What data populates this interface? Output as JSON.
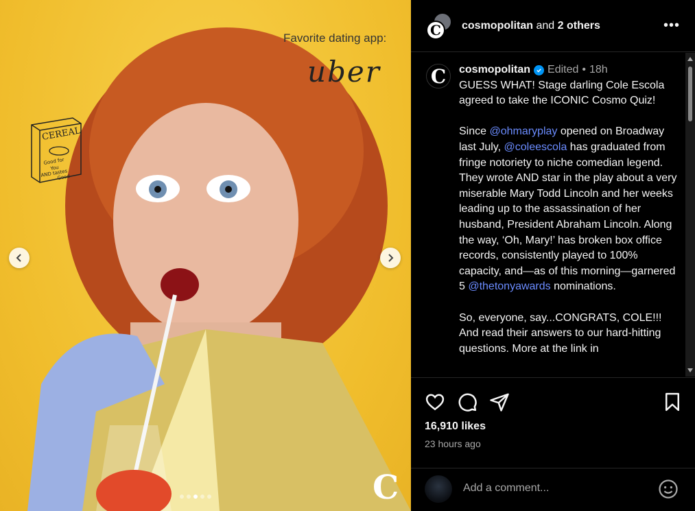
{
  "media": {
    "quiz_question": "Favorite dating app:",
    "quiz_answer": "uber",
    "cereal_box": [
      "CEREAL",
      "Good for",
      "You",
      "AND tastes",
      "Good"
    ],
    "brand_mark": "C",
    "dots_count": 5,
    "active_dot": 2
  },
  "header": {
    "username": "cosmopolitan",
    "joiner": "and",
    "others": "2 others",
    "avatar_letter": "C",
    "more_label": "•••"
  },
  "caption": {
    "avatar_letter": "C",
    "username": "cosmopolitan",
    "edited": "Edited",
    "separator": "•",
    "time": "18h",
    "p1": "GUESS WHAT! Stage darling Cole Escola agreed to take the ICONIC Cosmo Quiz!",
    "p2_a": "Since ",
    "p2_m1": "@ohmaryplay",
    "p2_b": " opened on Broadway last July, ",
    "p2_m2": "@coleescola",
    "p2_c": " has graduated from fringe notoriety to niche comedian legend. They wrote AND star in the play about a very miserable Mary Todd Lincoln and her weeks leading up to the assassination of her husband, President Abraham Lincoln. Along the way, ‘Oh, Mary!’ has broken box office records, consistently played to 100% capacity, and—as of this morning—garnered 5 ",
    "p2_m3": "@thetonyawards",
    "p2_d": " nominations.",
    "p3": "So, everyone, say...CONGRATS, COLE!!! And read their answers to our hard-hitting questions. More at the link in"
  },
  "actions": {
    "likes": "16,910 likes",
    "timestamp": "23 hours ago"
  },
  "comment": {
    "placeholder": "Add a comment..."
  },
  "colors": {
    "background": "#000000",
    "mention": "#6b8cff",
    "verified": "#0095f6",
    "media_bg": "#f2c232"
  }
}
